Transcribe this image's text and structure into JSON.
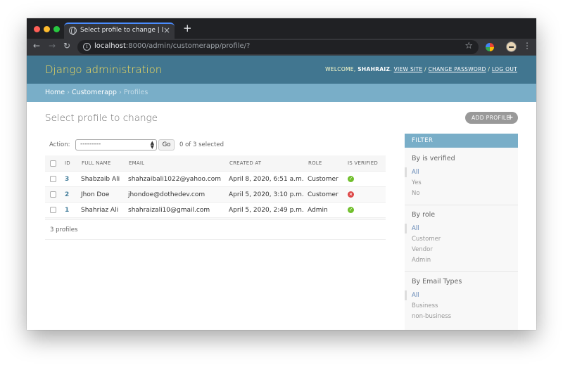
{
  "browser": {
    "tab_title": "Select profile to change | Django",
    "tab_close": "×",
    "new_tab": "+",
    "url_host": "localhost",
    "url_path": ":8000/admin/customerapp/profile/?",
    "back": "←",
    "forward": "→",
    "reload": "↻",
    "info": "i",
    "star": "☆",
    "menu": "⋮"
  },
  "header": {
    "branding": "Django administration",
    "welcome": "WELCOME,",
    "username": "SHAHRAIZ",
    "view_site": "VIEW SITE",
    "change_password": "CHANGE PASSWORD",
    "log_out": "LOG OUT",
    "sep": "/"
  },
  "breadcrumbs": {
    "home": "Home",
    "app": "Customerapp",
    "current": "Profiles",
    "sep": "›"
  },
  "page": {
    "title": "Select profile to change",
    "add_label": "ADD PROFILE",
    "add_plus": "+"
  },
  "actions": {
    "label": "Action:",
    "selected_value": "---------",
    "go": "Go",
    "selected_count": "0 of 3 selected"
  },
  "table": {
    "headers": [
      "ID",
      "FULL NAME",
      "EMAIL",
      "CREATED AT",
      "ROLE",
      "IS VERIFIED"
    ],
    "rows": [
      {
        "id": "3",
        "full_name": "Shabzaib Ali",
        "email": "shahzaibali1022@yahoo.com",
        "created_at": "April 8, 2020, 6:51 a.m.",
        "role": "Customer",
        "verified": true,
        "verified_glyph": "✓"
      },
      {
        "id": "2",
        "full_name": "Jhon Doe",
        "email": "jhondoe@dothedev.com",
        "created_at": "April 5, 2020, 3:10 p.m.",
        "role": "Customer",
        "verified": false,
        "verified_glyph": "×"
      },
      {
        "id": "1",
        "full_name": "Shahriaz Ali",
        "email": "shahraizali10@gmail.com",
        "created_at": "April 5, 2020, 2:49 p.m.",
        "role": "Admin",
        "verified": true,
        "verified_glyph": "✓"
      }
    ],
    "count": "3 profiles"
  },
  "filter": {
    "title": "FILTER",
    "groups": [
      {
        "title": "By is verified",
        "items": [
          "All",
          "Yes",
          "No"
        ]
      },
      {
        "title": "By role",
        "items": [
          "All",
          "Customer",
          "Vendor",
          "Admin"
        ]
      },
      {
        "title": "By Email Types",
        "items": [
          "All",
          "Business",
          "non-business"
        ]
      }
    ]
  },
  "colors": {
    "header_bg": "#417690",
    "breadcrumb_bg": "#79aec8",
    "branding": "#f5dd5d",
    "link": "#447e9b",
    "verified_yes": "#70bf2b",
    "verified_no": "#dd4646"
  }
}
